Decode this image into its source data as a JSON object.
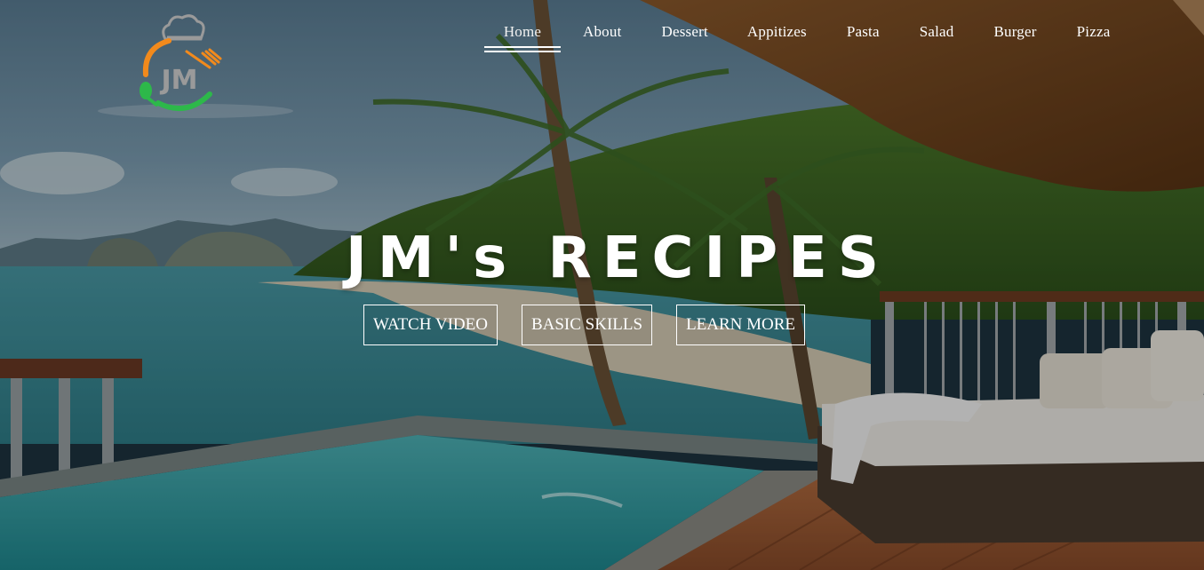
{
  "brand": {
    "logo_text": "JM"
  },
  "nav": {
    "items": [
      {
        "label": "Home",
        "active": true
      },
      {
        "label": "About"
      },
      {
        "label": "Dessert"
      },
      {
        "label": "Appitizes"
      },
      {
        "label": "Pasta"
      },
      {
        "label": "Salad"
      },
      {
        "label": "Burger"
      },
      {
        "label": "Pizza"
      }
    ]
  },
  "hero": {
    "headline": "JM's RECIPES",
    "buttons": [
      "WATCH VIDEO",
      "BASIC SKILLS",
      "LEARN MORE"
    ]
  },
  "colors": {
    "logo_orange": "#f28a1c",
    "logo_green": "#2db84a",
    "logo_grey": "#9a9a9a"
  }
}
